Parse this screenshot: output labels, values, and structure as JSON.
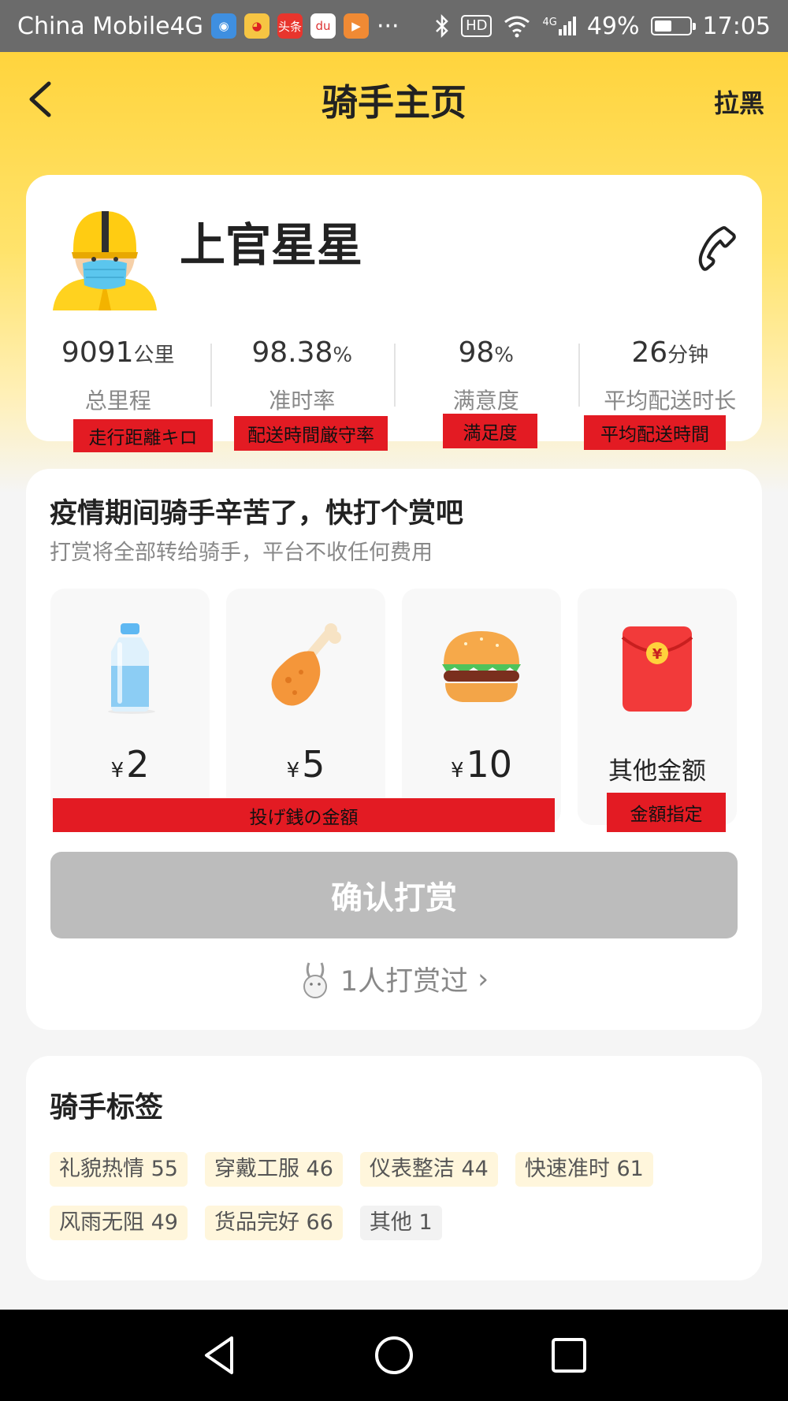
{
  "status_bar": {
    "carrier": "China Mobile4G",
    "app_icons": [
      "browser-icon",
      "weibo-icon",
      "toutiao-icon",
      "du-icon",
      "video-icon"
    ],
    "toutiao_text": "头条",
    "du_text": "du",
    "more": "···",
    "hd": "HD",
    "network": "4G",
    "battery_text": "49%",
    "battery_level": 0.49,
    "time": "17:05"
  },
  "nav": {
    "title": "骑手主页",
    "blacklist": "拉黑"
  },
  "profile": {
    "name": "上官星星",
    "stats": [
      {
        "value": "9091",
        "unit": "公里",
        "label": "总里程"
      },
      {
        "value": "98.38",
        "unit": "%",
        "label": "准时率"
      },
      {
        "value": "98",
        "unit": "%",
        "label": "满意度"
      },
      {
        "value": "26",
        "unit": "分钟",
        "label": "平均配送时长"
      }
    ]
  },
  "annotations": {
    "distance": "走行距離キロ",
    "ontime": "配送時間厳守率",
    "satisfaction": "満足度",
    "avg_time": "平均配送時間",
    "tip_amount": "投げ銭の金額",
    "custom_amount": "金額指定"
  },
  "tip": {
    "title": "疫情期间骑手辛苦了，快打个赏吧",
    "subtitle": "打赏将全部转给骑手，平台不收任何费用",
    "currency": "¥",
    "options": [
      {
        "icon": "water-bottle-icon",
        "amount": "2"
      },
      {
        "icon": "chicken-leg-icon",
        "amount": "5"
      },
      {
        "icon": "burger-icon",
        "amount": "10"
      },
      {
        "icon": "red-envelope-icon",
        "amount": "其他金额"
      }
    ],
    "envelope_symbol": "¥",
    "confirm": "确认打赏",
    "tippers": "1人打赏过",
    "tippers_arrow": "›"
  },
  "tags": {
    "title": "骑手标签",
    "items": [
      "礼貌热情 55",
      "穿戴工服 46",
      "仪表整洁 44",
      "快速准时 61",
      "风雨无阻 49",
      "货品完好 66",
      "其他 1"
    ]
  },
  "colors": {
    "header_yellow": "#ffd43d",
    "confirm_disabled": "#bcbcbc",
    "tag_bg": "#fff6dc",
    "annotation_red": "#e31b23"
  }
}
